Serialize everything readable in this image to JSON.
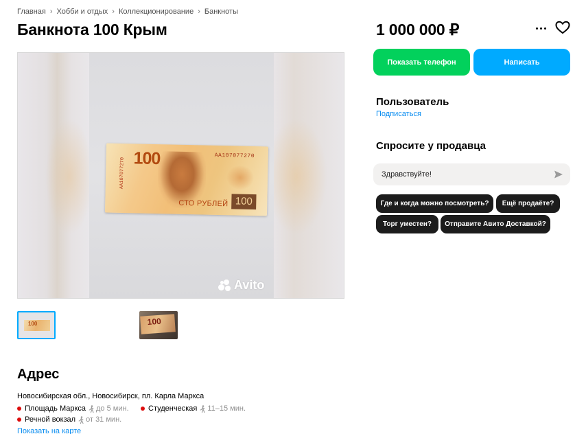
{
  "breadcrumbs": [
    "Главная",
    "Хобби и отдых",
    "Коллекционирование",
    "Банкноты"
  ],
  "listing": {
    "title": "Банкнота 100 Крым",
    "price": "1 000 000 ₽"
  },
  "photo": {
    "banknote_denomination": "100",
    "banknote_serial": "АА107077270",
    "banknote_words": "СТО РУБЛЕЙ",
    "banknote_box": "100",
    "watermark": "Avito",
    "thumbnail_count": 2,
    "selected_thumbnail": 1
  },
  "actions": {
    "show_phone": "Показать телефон",
    "write": "Написать"
  },
  "seller": {
    "name": "Пользователь",
    "subscribe": "Подписаться"
  },
  "ask": {
    "heading": "Спросите у продавца",
    "input_value": "Здравствуйте!",
    "chips": [
      "Где и когда можно посмотреть?",
      "Ещё продаёте?",
      "Торг уместен?",
      "Отправите Авито Доставкой?"
    ]
  },
  "address": {
    "heading": "Адрес",
    "line": "Новосибирская обл., Новосибирск, пл. Карла Маркса",
    "metro": [
      {
        "name": "Площадь Маркса",
        "walk": "до 5 мин."
      },
      {
        "name": "Студенческая",
        "walk": "11–15 мин."
      },
      {
        "name": "Речной вокзал",
        "walk": "от 31 мин."
      }
    ],
    "show_map": "Показать на карте"
  },
  "colors": {
    "green": "#02d15c",
    "blue": "#00aaff",
    "link": "#0a8df0",
    "metro_dot": "#dd0d0d",
    "chip_bg": "#1c1c1c"
  },
  "icons": {
    "more": "more-dots-icon",
    "favorite": "heart-icon",
    "send": "send-arrow-icon",
    "walk": "walking-person-icon",
    "breadcrumb_sep": "chevron-right-icon"
  }
}
